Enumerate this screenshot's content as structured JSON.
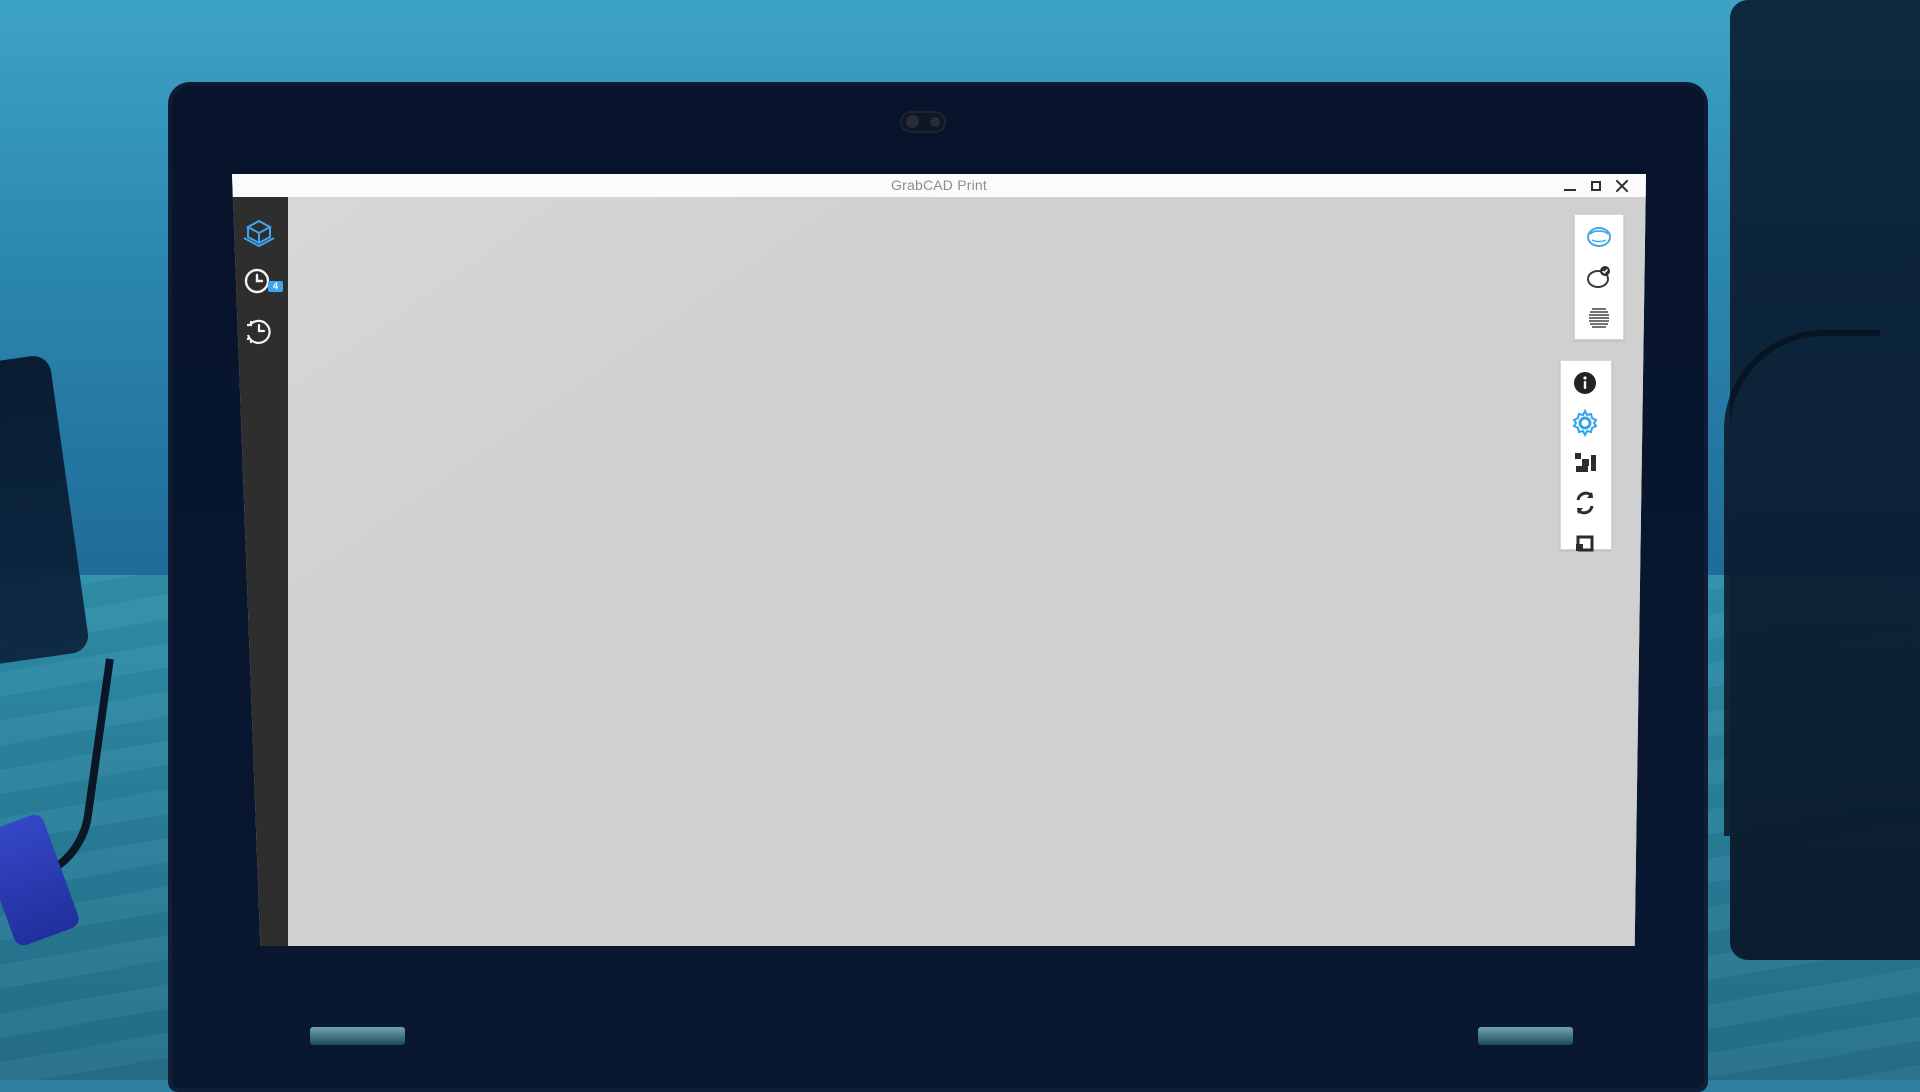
{
  "window": {
    "title": "GrabCAD Print"
  },
  "sidebar": {
    "items": [
      {
        "icon": "cube-icon",
        "active": true
      },
      {
        "icon": "queue-clock-icon",
        "badge": "4"
      },
      {
        "icon": "history-clock-icon"
      }
    ]
  },
  "toolbar": {
    "group_one": [
      {
        "icon": "view-mode-icon"
      },
      {
        "icon": "check-model-icon"
      },
      {
        "icon": "slice-layers-icon"
      }
    ],
    "group_two": [
      {
        "icon": "info-icon"
      },
      {
        "icon": "settings-icon"
      },
      {
        "icon": "arrange-icon"
      },
      {
        "icon": "rotate-icon"
      },
      {
        "icon": "scale-icon"
      }
    ]
  },
  "colors": {
    "accent": "#3ea6ee",
    "sidebar_bg": "#2e2e2e",
    "canvas_bg": "#d0d0d0",
    "titlebar_bg": "#fbfbfb"
  }
}
